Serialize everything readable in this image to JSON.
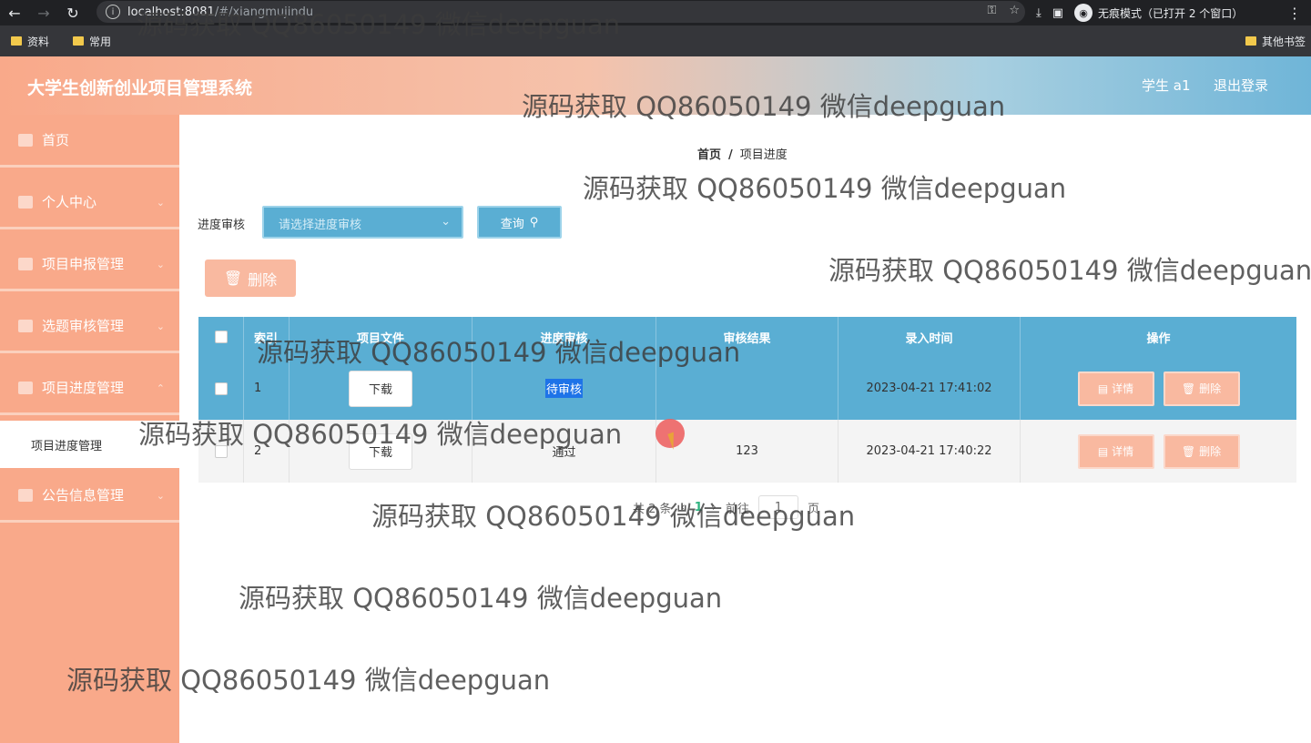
{
  "browser": {
    "url_host": "localhost:8081",
    "url_path": "/#/xiangmujindu",
    "incognito_label": "无痕模式（已打开 2 个窗口）",
    "bookmarks": [
      "资料",
      "常用"
    ],
    "other_bookmarks": "其他书签"
  },
  "header": {
    "title": "大学生创新创业项目管理系统",
    "user": "学生 a1",
    "logout": "退出登录"
  },
  "sidebar": {
    "items": [
      {
        "label": "首页",
        "icon": "home-icon"
      },
      {
        "label": "个人中心",
        "icon": "user-icon"
      },
      {
        "label": "项目申报管理",
        "icon": "grid-icon"
      },
      {
        "label": "选题审核管理",
        "icon": "user-icon"
      },
      {
        "label": "项目进度管理",
        "icon": "grid-icon"
      },
      {
        "label": "公告信息管理",
        "icon": "grid-icon"
      }
    ],
    "active_submenu": "项目进度管理"
  },
  "breadcrumb": {
    "home": "首页",
    "sep": "/",
    "current": "项目进度"
  },
  "filter": {
    "label": "进度审核",
    "placeholder": "请选择进度审核",
    "query_label": "查询"
  },
  "toolbar": {
    "delete_label": "删除"
  },
  "table": {
    "headers": [
      "索引",
      "项目文件",
      "进度审核",
      "审核结果",
      "录入时间",
      "操作"
    ],
    "rows": [
      {
        "index": "1",
        "file": "下载",
        "status": "待审核",
        "result": "",
        "time": "2023-04-21 17:41:02",
        "detail": "详情",
        "delete": "删除"
      },
      {
        "index": "2",
        "file": "下载",
        "status": "通过",
        "result": "123",
        "time": "2023-04-21 17:40:22",
        "detail": "详情",
        "delete": "删除"
      }
    ]
  },
  "pager": {
    "total": "共 2 条",
    "prev": "‹",
    "page": "1",
    "next": "›",
    "goto": "前往",
    "input": "1",
    "unit": "页"
  },
  "watermark": "源码获取 QQ86050149 微信deepguan"
}
